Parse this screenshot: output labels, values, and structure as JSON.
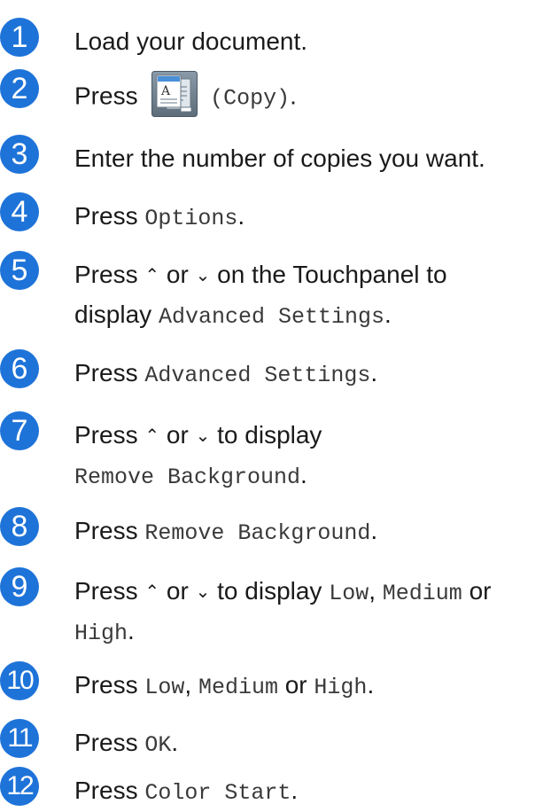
{
  "steps": [
    {
      "num": "1",
      "parts": [
        "Load your document."
      ]
    },
    {
      "num": "2",
      "press": "Press",
      "icon_name": "copy-icon",
      "copy_code": "(Copy)",
      "end": "."
    },
    {
      "num": "3",
      "parts": [
        "Enter the number of copies you want."
      ]
    },
    {
      "num": "4",
      "press": "Press",
      "code": "Options",
      "end": "."
    },
    {
      "num": "5",
      "press": "Press",
      "up_arrow": "⌃",
      "or": "or",
      "down_arrow": "⌄",
      "rest": "on the Touchpanel to",
      "display": "display",
      "code": "Advanced Settings",
      "end": "."
    },
    {
      "num": "6",
      "press": "Press",
      "code": "Advanced Settings",
      "end": "."
    },
    {
      "num": "7",
      "press": "Press",
      "up_arrow": "⌃",
      "or": "or",
      "down_arrow": "⌄",
      "rest": "to display",
      "code": "Remove Background",
      "end": "."
    },
    {
      "num": "8",
      "press": "Press",
      "code": "Remove Background",
      "end": "."
    },
    {
      "num": "9",
      "press": "Press",
      "up_arrow": "⌃",
      "or": "or",
      "down_arrow": "⌄",
      "rest": "to display",
      "code1": "Low",
      "sep": ",",
      "code2": "Medium",
      "or2": "or",
      "code3": "High",
      "end": "."
    },
    {
      "num": "10",
      "press": "Press",
      "code1": "Low",
      "sep": ",",
      "code2": "Medium",
      "or2": "or",
      "code3": "High",
      "end": "."
    },
    {
      "num": "11",
      "press": "Press",
      "code": "OK",
      "end": "."
    },
    {
      "num": "12",
      "press": "Press",
      "code": "Color Start",
      "end": "."
    }
  ],
  "colors": {
    "badge": "#1e73d8"
  }
}
